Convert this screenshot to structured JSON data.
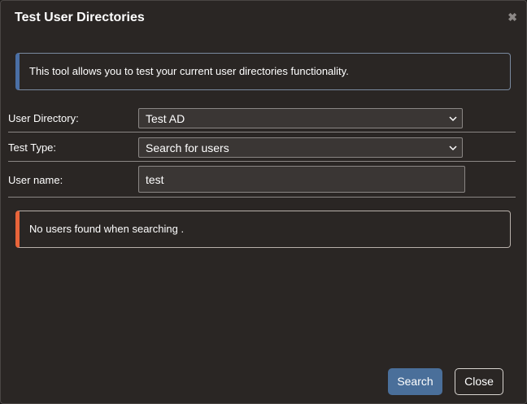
{
  "dialog": {
    "title": "Test User Directories",
    "close_icon": "close-icon"
  },
  "info": {
    "text": "This tool allows you to test your current user directories functionality.",
    "accent_color": "#4a6fa5"
  },
  "form": {
    "user_directory": {
      "label": "User Directory:",
      "value": "Test AD"
    },
    "test_type": {
      "label": "Test Type:",
      "value": "Search for users"
    },
    "user_name": {
      "label": "User name:",
      "value": "test",
      "placeholder": ""
    }
  },
  "result": {
    "text": "No users found when searching .",
    "accent_color": "#e8643a"
  },
  "buttons": {
    "search": "Search",
    "close": "Close"
  }
}
